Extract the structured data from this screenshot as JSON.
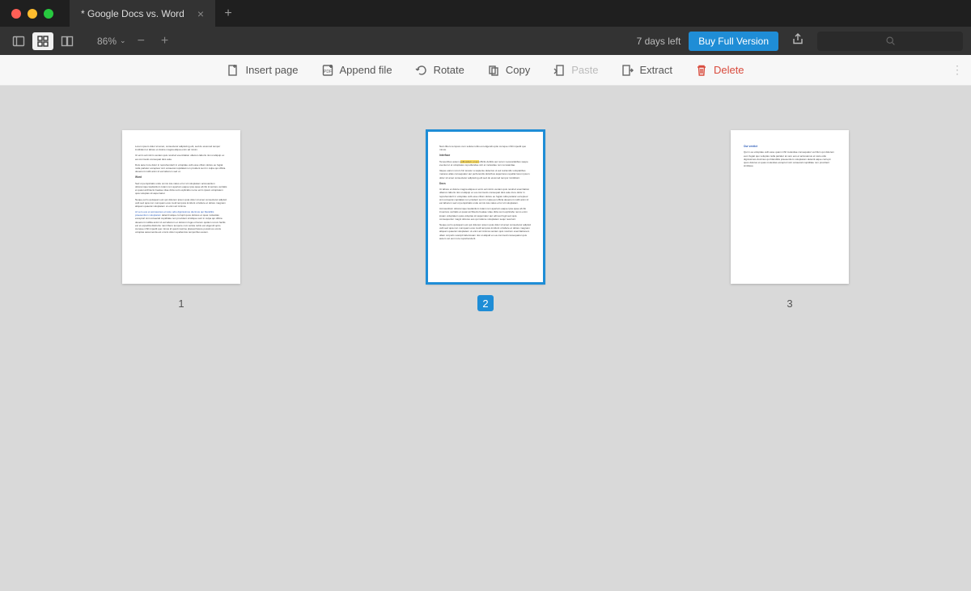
{
  "tab": {
    "title": "* Google Docs vs. Word"
  },
  "zoom": {
    "percent": "86%"
  },
  "trial": {
    "days_left": "7 days left",
    "buy": "Buy Full Version"
  },
  "actions": {
    "insert": "Insert page",
    "append": "Append file",
    "rotate": "Rotate",
    "copy": "Copy",
    "paste": "Paste",
    "extract": "Extract",
    "delete": "Delete"
  },
  "pages": {
    "p1": "1",
    "p2": "2",
    "p3": "3"
  },
  "selected_page": 2
}
